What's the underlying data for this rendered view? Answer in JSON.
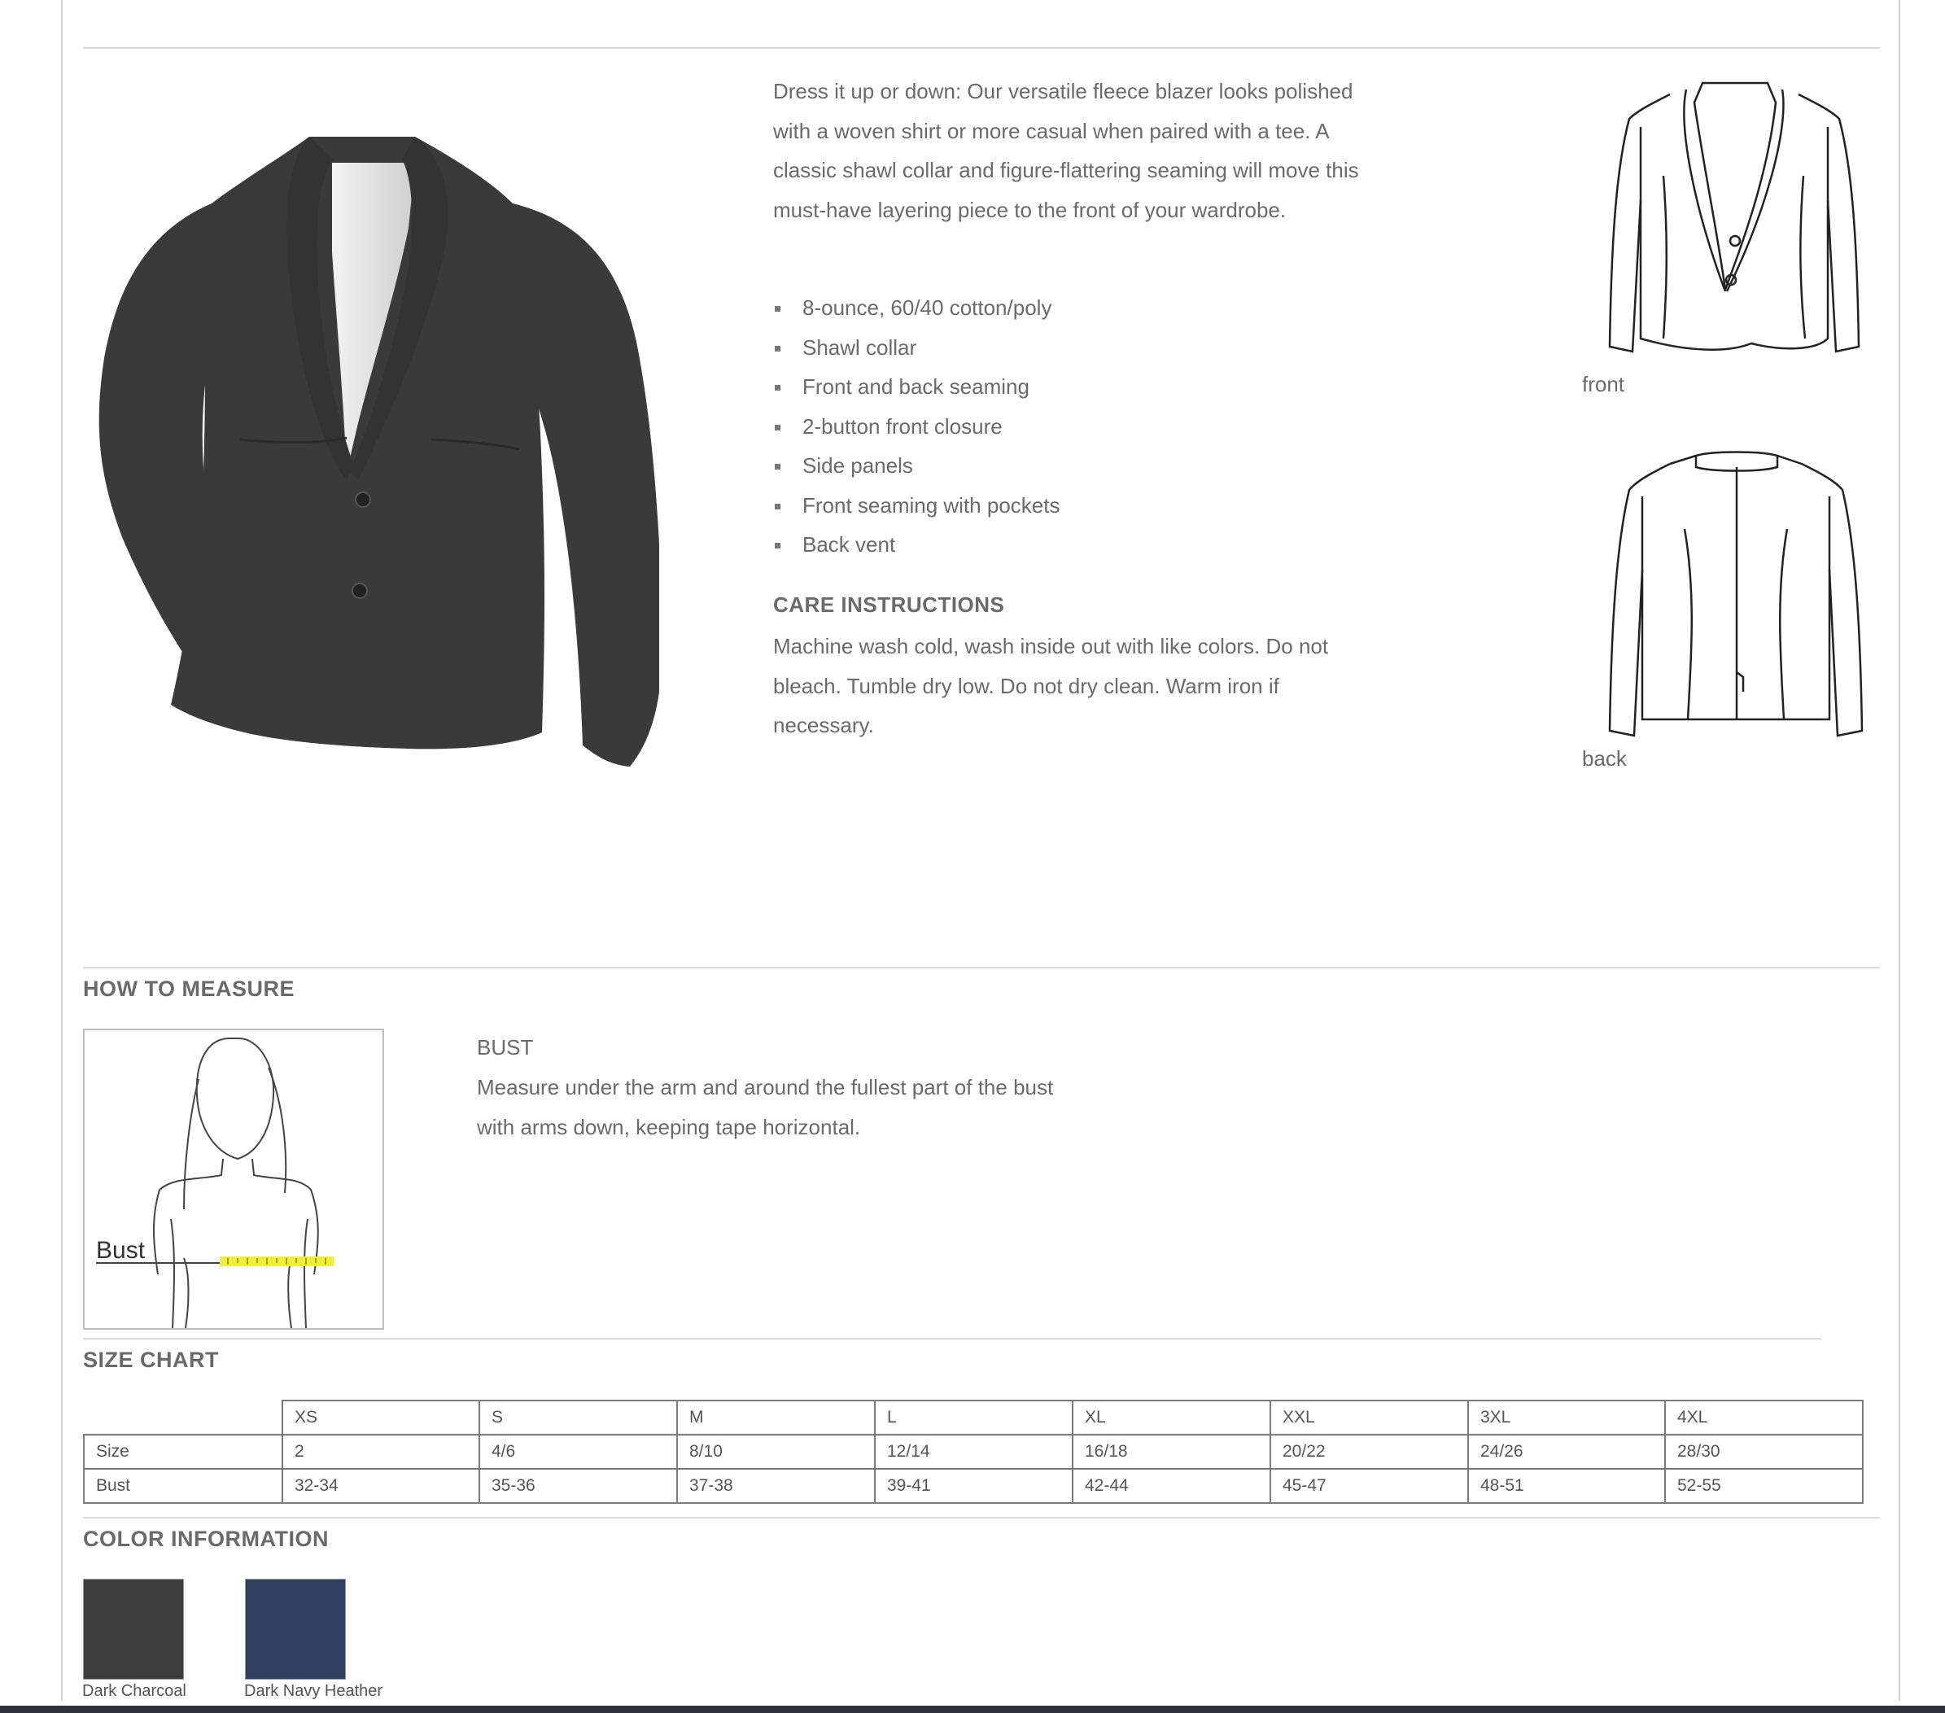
{
  "product": {
    "description": "Dress it up or down: Our versatile fleece blazer looks polished with a woven shirt or more casual when paired with a tee. A classic shawl collar and figure-flattering seaming will move this must-have layering piece to the front of your wardrobe.",
    "features": [
      "8-ounce, 60/40 cotton/poly",
      "Shawl collar",
      "Front and back seaming",
      "2-button front closure",
      "Side panels",
      "Front seaming with pockets",
      "Back vent"
    ],
    "care_title": "CARE INSTRUCTIONS",
    "care_text": "Machine wash cold, wash inside out with like colors. Do not bleach. Tumble dry low. Do not dry clean. Warm iron if necessary.",
    "jacket_color": "#3a3a3a"
  },
  "flats": {
    "front_label": "front",
    "back_label": "back"
  },
  "measure": {
    "section_title": "HOW TO MEASURE",
    "diagram_label": "Bust",
    "bust_title": "BUST",
    "bust_text": "Measure under the arm and around the fullest part of the bust with arms down, keeping tape horizontal."
  },
  "size_chart": {
    "section_title": "SIZE CHART",
    "columns": [
      "XS",
      "S",
      "M",
      "L",
      "XL",
      "XXL",
      "3XL",
      "4XL"
    ],
    "rows": [
      {
        "label": "Size",
        "values": [
          "2",
          "4/6",
          "8/10",
          "12/14",
          "16/18",
          "20/22",
          "24/26",
          "28/30"
        ]
      },
      {
        "label": "Bust",
        "values": [
          "32-34",
          "35-36",
          "37-38",
          "39-41",
          "42-44",
          "45-47",
          "48-51",
          "52-55"
        ]
      }
    ]
  },
  "colors": {
    "section_title": "COLOR INFORMATION",
    "swatches": [
      {
        "name": "Dark Charcoal",
        "hex": "#3d3d3d"
      },
      {
        "name": "Dark Navy Heather",
        "hex": "#2f4160"
      }
    ]
  }
}
